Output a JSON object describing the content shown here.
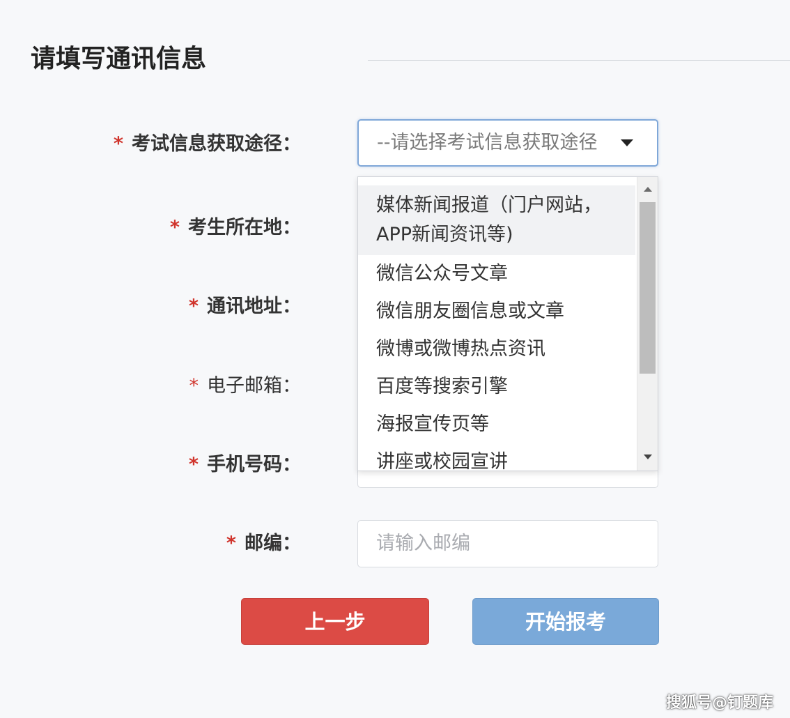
{
  "page": {
    "title": "请填写通讯信息"
  },
  "form": {
    "info_source": {
      "label": "考试信息获取途径：",
      "required_mark": "*",
      "select_value": "--请选择考试信息获取途径"
    },
    "location": {
      "label": "考生所在地：",
      "required_mark": "*"
    },
    "address": {
      "label": "通讯地址：",
      "required_mark": "*"
    },
    "email": {
      "label": "电子邮箱：",
      "required_mark": "*"
    },
    "phone": {
      "label": "手机号码：",
      "required_mark": "*"
    },
    "postcode": {
      "label": "邮编：",
      "required_mark": "*",
      "placeholder": "请输入邮编"
    }
  },
  "dropdown": {
    "options": [
      "媒体新闻报道（门户网站，APP新闻资讯等)",
      "微信公众号文章",
      "微信朋友圈信息或文章",
      "微博或微博热点资讯",
      "百度等搜索引擎",
      "海报宣传页等",
      "讲座或校园宣讲"
    ]
  },
  "buttons": {
    "prev_label": "上一步",
    "start_label": "开始报考"
  },
  "watermark": {
    "text": "搜狐号@钉题库"
  },
  "colors": {
    "required": "#d0342c",
    "prev_button": "#dc4b45",
    "start_button": "#7aa9d9",
    "select_focus_border": "#7fa7d8"
  }
}
